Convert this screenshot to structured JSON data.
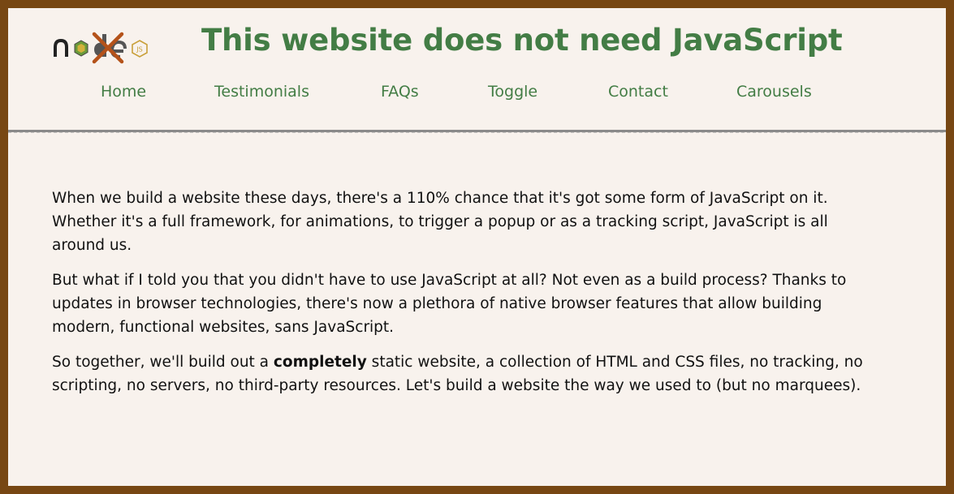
{
  "header": {
    "logo_text": "node JS",
    "title": "This website does not need JavaScript"
  },
  "nav": {
    "items": [
      {
        "label": "Home"
      },
      {
        "label": "Testimonials"
      },
      {
        "label": "FAQs"
      },
      {
        "label": "Toggle"
      },
      {
        "label": "Contact"
      },
      {
        "label": "Carousels"
      }
    ]
  },
  "main": {
    "p1": "When we build a website these days, there's a 110% chance that it's got some form of JavaScript on it. Whether it's a full framework, for animations, to trigger a popup or as a tracking script, JavaScript is all around us.",
    "p2": "But what if I told you that you didn't have to use JavaScript at all? Not even as a build process? Thanks to updates in browser technologies, there's now a plethora of native browser features that allow building modern, functional websites, sans JavaScript.",
    "p3": {
      "before": "So together, we'll build out a ",
      "emphasis": "completely",
      "after": " static website, a collection of HTML and CSS files, no tracking, no scripting, no servers, no third-party resources. Let's build a website the way we used to (but no marquees)."
    }
  },
  "colors": {
    "border": "#774713",
    "background": "#f8f2ed",
    "accent_green": "#437d45",
    "cross_orange": "#b4521a",
    "text": "#111111"
  },
  "icons": {
    "logo": "node-js-crossed-out-icon"
  }
}
